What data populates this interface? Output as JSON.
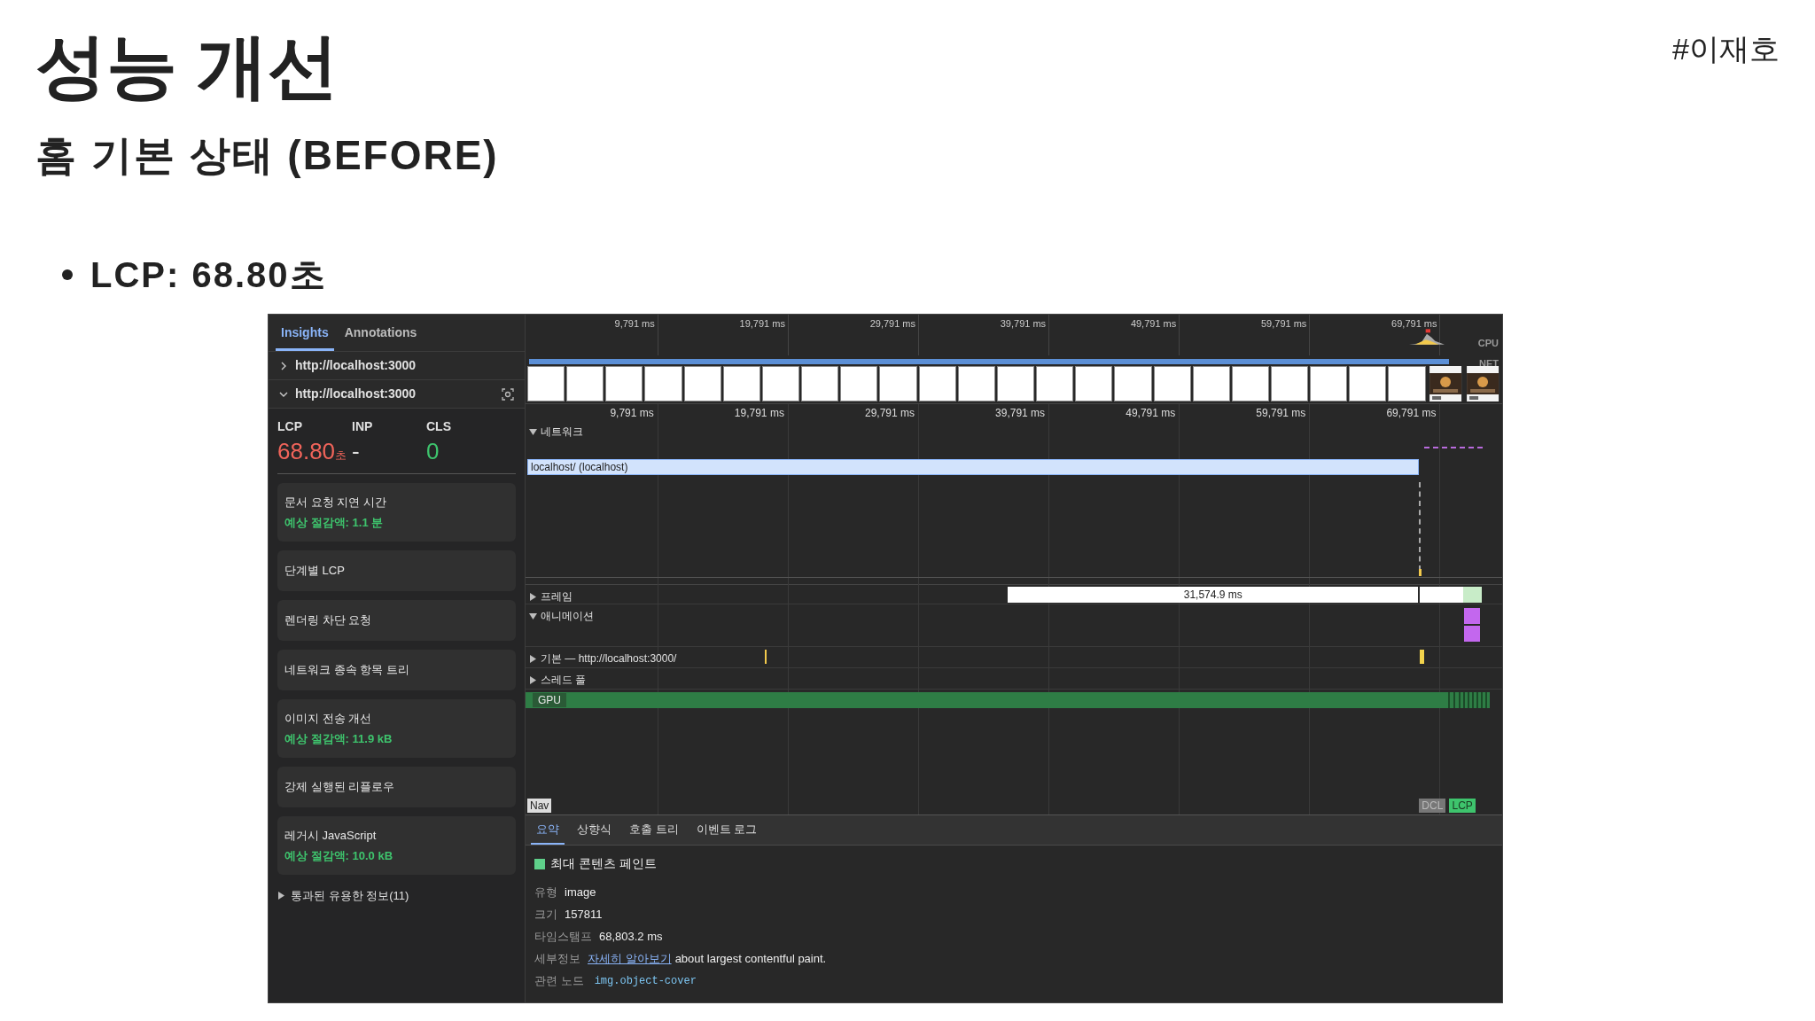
{
  "slide": {
    "title": "성능 개선",
    "tag": "#이재호",
    "subtitle": "홈 기본 상태 (BEFORE)",
    "bullets": [
      "LCP: 68.80초"
    ]
  },
  "devtools": {
    "sidebar": {
      "tabs": [
        {
          "label": "Insights",
          "selected": true
        },
        {
          "label": "Annotations",
          "selected": false
        }
      ],
      "traces": [
        {
          "label": "http://localhost:3000",
          "expanded": false
        },
        {
          "label": "http://localhost:3000",
          "expanded": true
        }
      ],
      "metrics": [
        {
          "label": "LCP",
          "value": "68.80",
          "unit": "초",
          "color": "#f0645a"
        },
        {
          "label": "INP",
          "value": "-",
          "color": "#e0e0e0"
        },
        {
          "label": "CLS",
          "value": "0",
          "color": "#3ec46d"
        }
      ],
      "insights": [
        {
          "title": "문서 요청 지연 시간",
          "savings": "예상 절감액: 1.1 분"
        },
        {
          "title": "단계별 LCP"
        },
        {
          "title": "렌더링 차단 요청"
        },
        {
          "title": "네트워크 종속 항목 트리"
        },
        {
          "title": "이미지 전송 개선",
          "savings": "예상 절감액: 11.9 kB"
        },
        {
          "title": "강제 실행된 리플로우"
        },
        {
          "title": "레거시 JavaScript",
          "savings": "예상 절감액: 10.0 kB"
        }
      ],
      "passed": {
        "label": "통과된 유용한 정보(11)",
        "expanded": false
      }
    },
    "timeline": {
      "overview_ticks": [
        "9,791 ms",
        "19,791 ms",
        "29,791 ms",
        "39,791 ms",
        "49,791 ms",
        "59,791 ms",
        "69,791 ms"
      ],
      "overview_labels": [
        "CPU",
        "NET"
      ],
      "ticks": [
        "9,791 ms",
        "19,791 ms",
        "29,791 ms",
        "39,791 ms",
        "49,791 ms",
        "59,791 ms",
        "69,791 ms"
      ],
      "tracks": [
        {
          "kind": "network",
          "label": "네트워크",
          "expanded": true,
          "request": "localhost/ (localhost)"
        },
        {
          "kind": "frames",
          "label": "프레임",
          "expanded": false,
          "bar": "31,574.9 ms"
        },
        {
          "kind": "animations",
          "label": "애니메이션",
          "expanded": true
        },
        {
          "kind": "main",
          "label": "기본 — http://localhost:3000/",
          "expanded": false
        },
        {
          "kind": "threadpool",
          "label": "스레드 풀",
          "expanded": false
        },
        {
          "kind": "gpu",
          "label": "GPU"
        }
      ],
      "markers": [
        {
          "label": "Nav",
          "kind": "nav"
        },
        {
          "label": "DCL",
          "kind": "dcl"
        },
        {
          "label": "LCP",
          "kind": "lcp"
        }
      ]
    },
    "details": {
      "tabs": [
        {
          "label": "요약",
          "selected": true
        },
        {
          "label": "상향식",
          "selected": false
        },
        {
          "label": "호출 트리",
          "selected": false
        },
        {
          "label": "이벤트 로그",
          "selected": false
        }
      ],
      "event": {
        "title": "최대 콘텐츠 페인트",
        "color": "#5fd08a"
      },
      "fields": [
        {
          "kind": "text",
          "label": "유형",
          "value": "image"
        },
        {
          "kind": "text",
          "label": "크기",
          "value": "157811"
        },
        {
          "kind": "text",
          "label": "타임스탬프",
          "value": "68,803.2 ms"
        },
        {
          "kind": "link",
          "label": "세부정보",
          "link": "자세히 알아보기",
          "value": "about largest contentful paint."
        },
        {
          "kind": "code",
          "label": "관련 노드",
          "value": "img.object-cover"
        }
      ]
    }
  }
}
